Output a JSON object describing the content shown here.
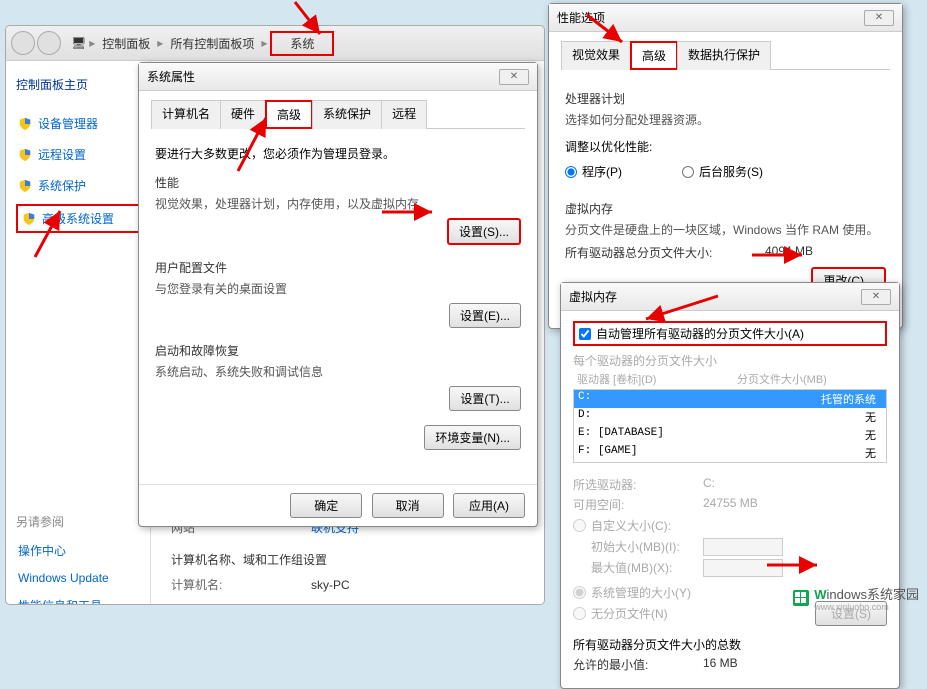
{
  "cp": {
    "breadcrumb": [
      "控制面板",
      "所有控制面板项",
      "系统"
    ],
    "sidebar_title": "控制面板主页",
    "links": [
      "设备管理器",
      "远程设置",
      "系统保护",
      "高级系统设置"
    ],
    "see_also_title": "另请参阅",
    "see_also": [
      "操作中心",
      "Windows Update",
      "性能信息和工具"
    ],
    "content": {
      "website_label": "网站",
      "website_val": "联机支持",
      "cnd_heading": "计算机名称、域和工作组设置",
      "cname_label": "计算机名:",
      "cname_val": "sky-PC"
    }
  },
  "sysprop": {
    "title": "系统属性",
    "tabs": [
      "计算机名",
      "硬件",
      "高级",
      "系统保护",
      "远程"
    ],
    "active_tab": 2,
    "admin_note": "要进行大多数更改，您必须作为管理员登录。",
    "sections": {
      "perf": {
        "title": "性能",
        "desc": "视觉效果，处理器计划，内存使用，以及虚拟内存",
        "btn": "设置(S)..."
      },
      "profile": {
        "title": "用户配置文件",
        "desc": "与您登录有关的桌面设置",
        "btn": "设置(E)..."
      },
      "startup": {
        "title": "启动和故障恢复",
        "desc": "系统启动、系统失败和调试信息",
        "btn": "设置(T)..."
      }
    },
    "env_btn": "环境变量(N)...",
    "footer": {
      "ok": "确定",
      "cancel": "取消",
      "apply": "应用(A)"
    }
  },
  "perfopt": {
    "title": "性能选项",
    "tabs": [
      "视觉效果",
      "高级",
      "数据执行保护"
    ],
    "active_tab": 1,
    "proc_sched": {
      "title": "处理器计划",
      "desc": "选择如何分配处理器资源。",
      "adjust": "调整以优化性能:",
      "opt_program": "程序(P)",
      "opt_bg": "后台服务(S)",
      "selected": 0
    },
    "vmem": {
      "title": "虚拟内存",
      "desc": "分页文件是硬盘上的一块区域，Windows 当作 RAM 使用。",
      "total_label": "所有驱动器总分页文件大小:",
      "total_val": "4094 MB",
      "change_btn": "更改(C)..."
    }
  },
  "vmem_dlg": {
    "title": "虚拟内存",
    "auto_chk": "自动管理所有驱动器的分页文件大小(A)",
    "auto_checked": true,
    "list_title": "每个驱动器的分页文件大小",
    "hdr_drive": "驱动器 [卷标](D)",
    "hdr_size": "分页文件大小(MB)",
    "drives": [
      {
        "d": "C:",
        "label": "",
        "size": "托管的系统",
        "sel": true
      },
      {
        "d": "D:",
        "label": "",
        "size": "无"
      },
      {
        "d": "E:",
        "label": "[DATABASE]",
        "size": "无"
      },
      {
        "d": "F:",
        "label": "[GAME]",
        "size": "无"
      }
    ],
    "selected_drive_label": "所选驱动器:",
    "selected_drive_val": "C:",
    "avail_label": "可用空间:",
    "avail_val": "24755 MB",
    "opt_custom": "自定义大小(C):",
    "init_label": "初始大小(MB)(I):",
    "max_label": "最大值(MB)(X):",
    "opt_sys": "系统管理的大小(Y)",
    "opt_none": "无分页文件(N)",
    "set_btn": "设置(S)",
    "total_heading": "所有驱动器分页文件大小的总数",
    "min_label": "允许的最小值:",
    "min_val": "16 MB"
  },
  "watermark": {
    "brand": "indows",
    "suffix": "系统家园",
    "url": "www.xinluobo.com"
  }
}
